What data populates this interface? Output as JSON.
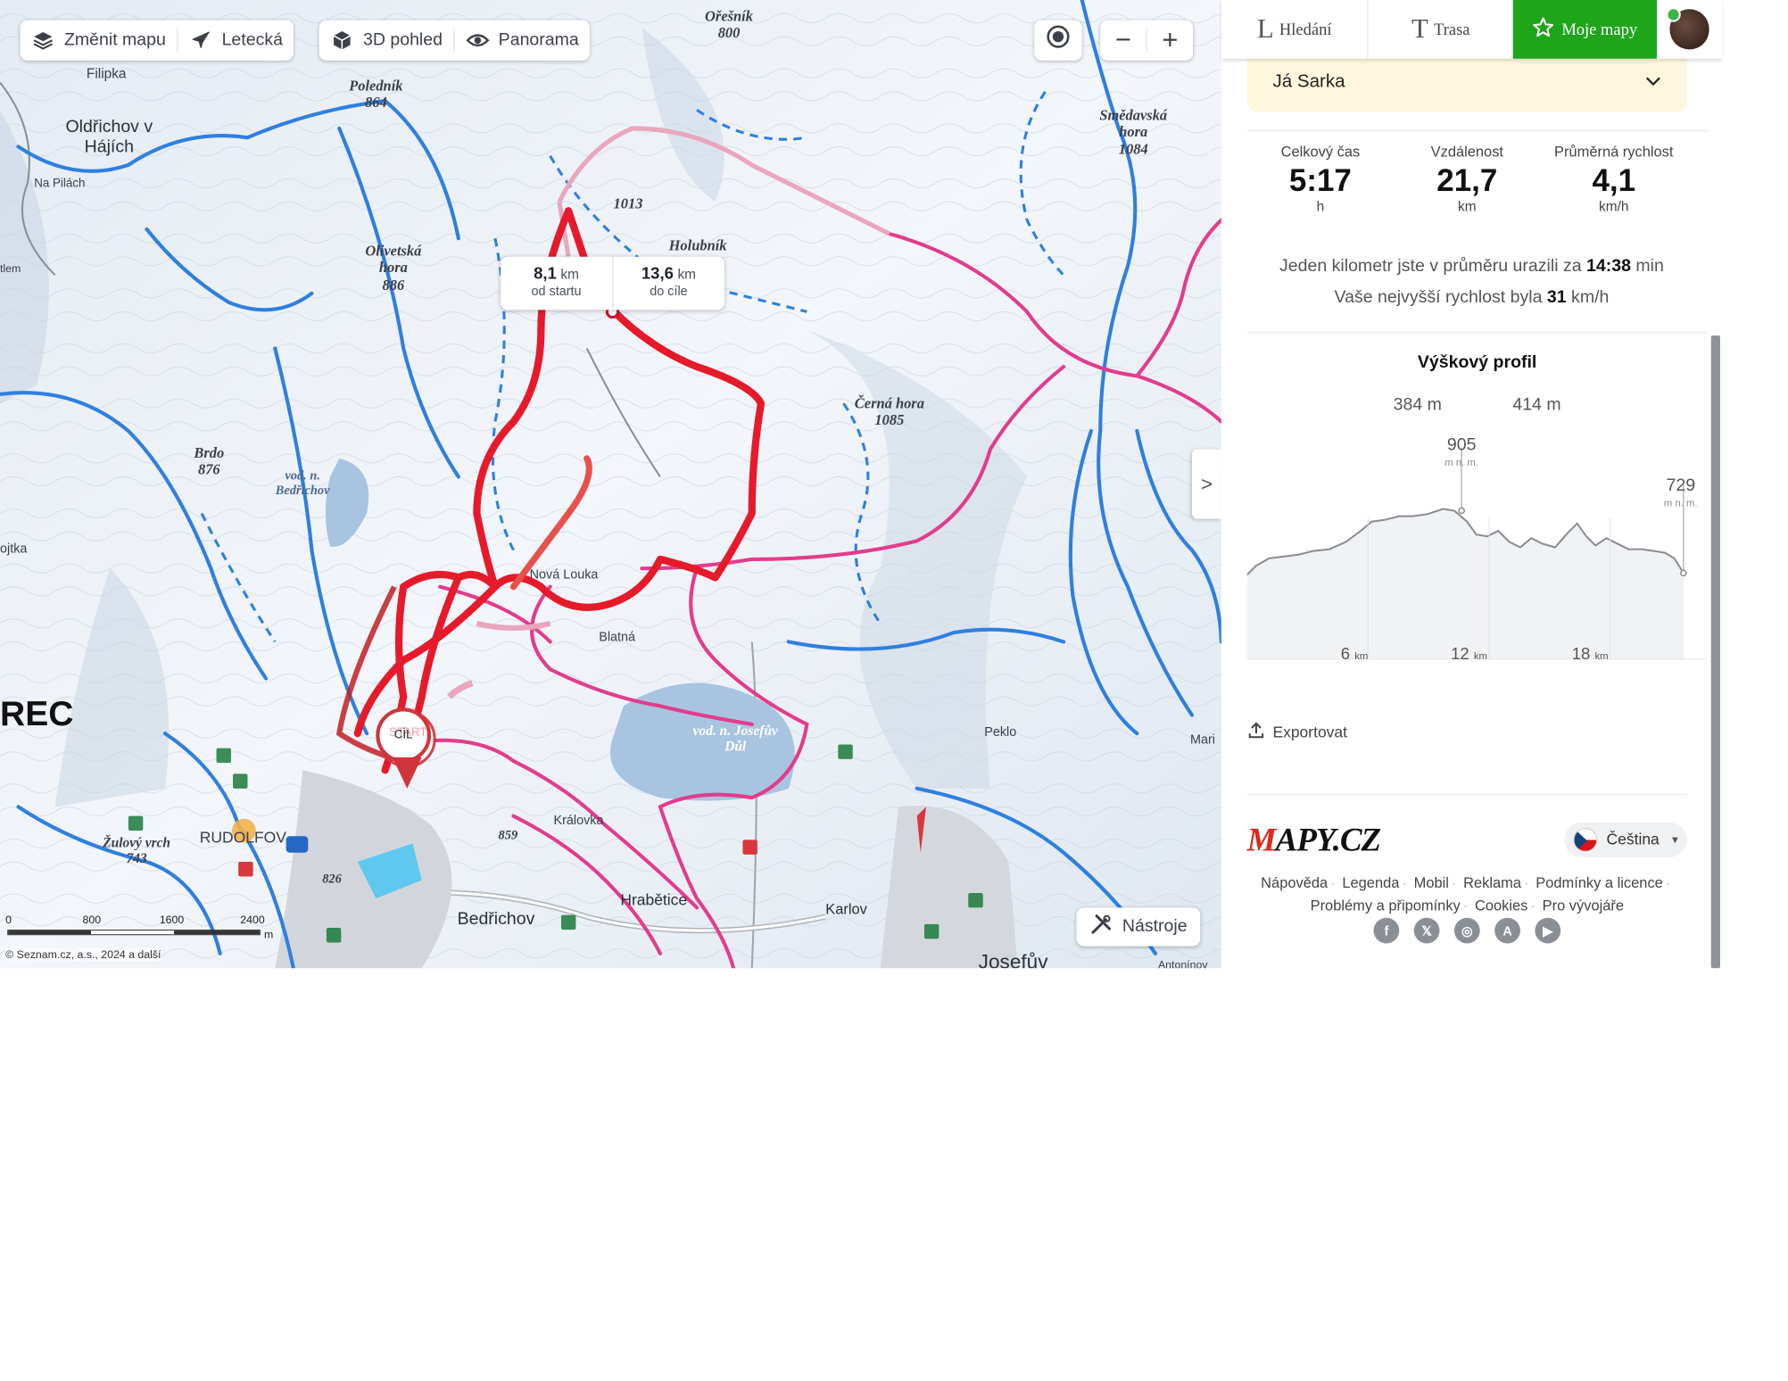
{
  "map_controls": {
    "change_map": "Změnit mapu",
    "aerial": "Letecká",
    "view_3d": "3D pohled",
    "panorama": "Panorama",
    "tools": "Nástroje",
    "collapse": ">"
  },
  "map_labels": {
    "oldrichov": "Oldřichov v Hájích",
    "na_pilach": "Na Pilách",
    "filipka": "Filipka",
    "polednik": "Poledník",
    "polednik_ele": "864",
    "oresnik": "Ořešník",
    "oresnik_ele": "800",
    "peak_1013": "1013",
    "olivetska": "Olivetská hora",
    "olivetska_ele": "886",
    "holubnik": "Holubník",
    "smedavska": "Smědavská hora",
    "smedavska_ele": "1084",
    "cerna_hora": "Černá hora",
    "cerna_hora_ele": "1085",
    "brdo": "Brdo",
    "brdo_ele": "876",
    "vod_bedrichov": "vod. n. Bedřichov",
    "nova_louka": "Nová Louka",
    "blatna": "Blatná",
    "vod_josefuv": "vod. n. Josefův Důl",
    "rec": "REC",
    "ojtka": "ojtka",
    "tlem": "tlem",
    "zulovy": "Žulový vrch",
    "zulovy_ele": "743",
    "rudolfov": "RUDOLFOV",
    "ele_826": "826",
    "ele_859": "859",
    "kralovka": "Královka",
    "bedrichov": "Bedřichov",
    "hrabetice": "Hrabětice",
    "karlov": "Karlov",
    "peklo": "Peklo",
    "mari": "Mari",
    "josefuv_dul": "Josefův",
    "antonin": "Antonínov",
    "start": "START",
    "cil": "CÍL"
  },
  "distance_popup": {
    "from_start_value": "8,1",
    "from_start_unit": "km",
    "from_start_label": "od startu",
    "to_end_value": "13,6",
    "to_end_unit": "km",
    "to_end_label": "do cíle"
  },
  "scale_bar": {
    "ticks": [
      "0",
      "800",
      "1600",
      "2400"
    ],
    "unit": "m"
  },
  "copyright": "© Seznam.cz, a.s., 2024 a další",
  "nav": {
    "search": "Hledání",
    "route": "Trasa",
    "my_maps": "Moje mapy",
    "search_glyph": "L",
    "route_glyph": "T"
  },
  "owner": "Já Sarka",
  "stats": [
    {
      "label": "Celkový čas",
      "value": "5:17",
      "unit": "h"
    },
    {
      "label": "Vzdálenost",
      "value": "21,7",
      "unit": "km"
    },
    {
      "label": "Průměrná rychlost",
      "value": "4,1",
      "unit": "km/h"
    }
  ],
  "pace": {
    "prefix": "Jeden kilometr jste v průměru urazili za",
    "value": "14:38",
    "suffix": "min"
  },
  "top_speed": {
    "prefix": "Vaše nejvyšší rychlost byla",
    "value": "31",
    "suffix": "km/h"
  },
  "elevation_profile": {
    "title": "Výškový profil",
    "ascent": "384 m",
    "descent": "414 m",
    "max_value": "905",
    "max_unit": "m n. m.",
    "end_value": "729",
    "end_unit": "m n. m.",
    "x_ticks": [
      {
        "value": "6",
        "unit": "km"
      },
      {
        "value": "12",
        "unit": "km"
      },
      {
        "value": "18",
        "unit": "km"
      }
    ]
  },
  "export": "Exportovat",
  "footer": {
    "logo_m": "M",
    "logo_rest": "APY.CZ",
    "language": "Čeština",
    "links_row1": [
      "Nápověda",
      "Legenda",
      "Mobil",
      "Reklama",
      "Podmínky a licence"
    ],
    "links_row2": [
      "Problémy a připomínky",
      "Cookies",
      "Pro vývojáře"
    ],
    "social": [
      "f",
      "x",
      "ig",
      "app-store",
      "google-play"
    ]
  }
}
